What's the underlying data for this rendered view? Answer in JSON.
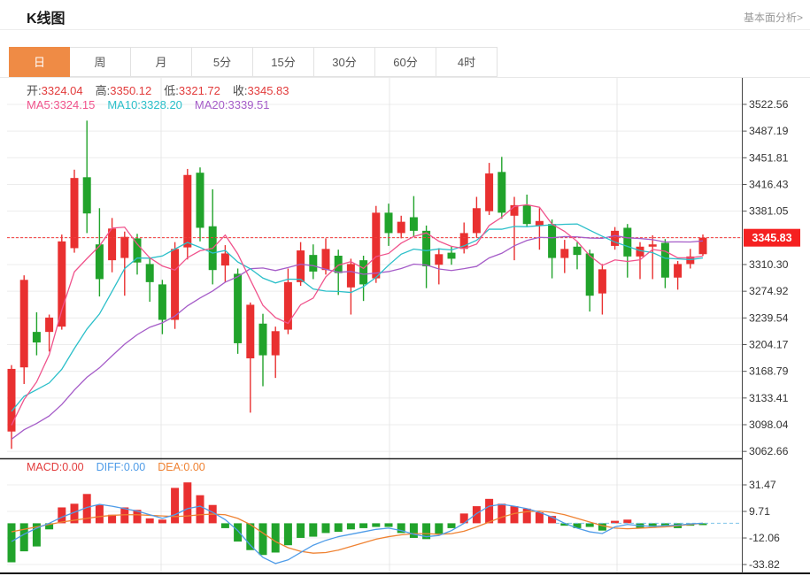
{
  "header": {
    "title": "K线图",
    "link": "基本面分析>"
  },
  "tabs": [
    {
      "label": "日",
      "active": true
    },
    {
      "label": "周",
      "active": false
    },
    {
      "label": "月",
      "active": false
    },
    {
      "label": "5分",
      "active": false
    },
    {
      "label": "15分",
      "active": false
    },
    {
      "label": "30分",
      "active": false
    },
    {
      "label": "60分",
      "active": false
    },
    {
      "label": "4时",
      "active": false
    }
  ],
  "ohlc": [
    {
      "label": "开:",
      "value": "3324.04"
    },
    {
      "label": "高:",
      "value": "3350.12"
    },
    {
      "label": "低:",
      "value": "3321.72"
    },
    {
      "label": "收:",
      "value": "3345.83"
    }
  ],
  "ma_legend": [
    {
      "label": "MA5:",
      "value": "3324.15",
      "color": "#f0538c"
    },
    {
      "label": "MA10:",
      "value": "3328.20",
      "color": "#2bbfc9"
    },
    {
      "label": "MA20:",
      "value": "3339.51",
      "color": "#a55cc8"
    }
  ],
  "macd_legend": [
    {
      "label": "MACD:",
      "value": "0.00",
      "color": "#e23b3b"
    },
    {
      "label": "DIFF:",
      "value": "0.00",
      "color": "#4f9ce8"
    },
    {
      "label": "DEA:",
      "value": "0.00",
      "color": "#ef8232"
    }
  ],
  "chart_data": {
    "type": "candlestick+macd",
    "title": "K线图",
    "legend_position": "top-left",
    "grid": true,
    "price_axis_ticks": [
      3522.56,
      3487.19,
      3451.81,
      3416.43,
      3381.05,
      3345.83,
      3310.3,
      3274.92,
      3239.54,
      3204.17,
      3168.79,
      3133.41,
      3098.04,
      3062.66
    ],
    "current_price": 3345.83,
    "current_price_label": "3345.83",
    "ma_current": {
      "ma5": 3324.15,
      "ma10": 3328.2,
      "ma20": 3339.51
    },
    "candles_ohlc": [
      [
        3089,
        3177,
        3066,
        3172
      ],
      [
        3174,
        3296,
        3152,
        3290
      ],
      [
        3221,
        3247,
        3190,
        3207
      ],
      [
        3221,
        3244,
        3195,
        3240
      ],
      [
        3228,
        3350,
        3224,
        3341
      ],
      [
        3332,
        3436,
        3326,
        3425
      ],
      [
        3426,
        3501,
        3352,
        3378
      ],
      [
        3337,
        3385,
        3268,
        3291
      ],
      [
        3316,
        3372,
        3300,
        3358
      ],
      [
        3319,
        3354,
        3269,
        3347
      ],
      [
        3345,
        3351,
        3297,
        3313
      ],
      [
        3311,
        3320,
        3261,
        3287
      ],
      [
        3284,
        3290,
        3218,
        3237
      ],
      [
        3237,
        3340,
        3225,
        3331
      ],
      [
        3333,
        3437,
        3317,
        3429
      ],
      [
        3432,
        3439,
        3341,
        3359
      ],
      [
        3361,
        3410,
        3284,
        3303
      ],
      [
        3309,
        3336,
        3287,
        3325
      ],
      [
        3298,
        3305,
        3192,
        3206
      ],
      [
        3186,
        3260,
        3114,
        3257
      ],
      [
        3232,
        3245,
        3149,
        3190
      ],
      [
        3190,
        3228,
        3160,
        3222
      ],
      [
        3224,
        3305,
        3218,
        3287
      ],
      [
        3287,
        3340,
        3282,
        3329
      ],
      [
        3323,
        3337,
        3291,
        3301
      ],
      [
        3303,
        3345,
        3297,
        3331
      ],
      [
        3322,
        3330,
        3270,
        3299
      ],
      [
        3280,
        3318,
        3244,
        3311
      ],
      [
        3316,
        3322,
        3262,
        3284
      ],
      [
        3292,
        3388,
        3286,
        3379
      ],
      [
        3379,
        3391,
        3335,
        3352
      ],
      [
        3352,
        3375,
        3345,
        3367
      ],
      [
        3373,
        3401,
        3347,
        3355
      ],
      [
        3355,
        3362,
        3279,
        3308
      ],
      [
        3310,
        3332,
        3284,
        3324
      ],
      [
        3326,
        3334,
        3310,
        3318
      ],
      [
        3331,
        3366,
        3325,
        3352
      ],
      [
        3352,
        3400,
        3346,
        3385
      ],
      [
        3381,
        3445,
        3376,
        3431
      ],
      [
        3433,
        3453,
        3371,
        3379
      ],
      [
        3375,
        3400,
        3316,
        3389
      ],
      [
        3389,
        3403,
        3360,
        3364
      ],
      [
        3362,
        3385,
        3330,
        3368
      ],
      [
        3364,
        3370,
        3292,
        3319
      ],
      [
        3319,
        3343,
        3299,
        3331
      ],
      [
        3334,
        3340,
        3304,
        3323
      ],
      [
        3325,
        3330,
        3248,
        3269
      ],
      [
        3272,
        3311,
        3244,
        3304
      ],
      [
        3335,
        3360,
        3330,
        3355
      ],
      [
        3359,
        3364,
        3293,
        3321
      ],
      [
        3321,
        3340,
        3291,
        3334
      ],
      [
        3334,
        3349,
        3291,
        3337
      ],
      [
        3339,
        3344,
        3279,
        3293
      ],
      [
        3293,
        3315,
        3277,
        3311
      ],
      [
        3311,
        3331,
        3305,
        3321
      ],
      [
        3324.04,
        3350.12,
        3321.72,
        3345.83
      ]
    ],
    "macd_axis_ticks": [
      31.47,
      9.71,
      -12.06,
      -33.82
    ],
    "macd_current": {
      "macd": 0.0,
      "diff": 0.0,
      "dea": 0.0
    },
    "macd_bars": [
      -32,
      -23,
      -19,
      -5,
      13,
      16,
      24,
      15,
      7,
      13,
      11,
      4,
      3,
      29,
      33.5,
      23,
      15,
      -4,
      -15,
      -22,
      -26,
      -24,
      -18,
      -12,
      -11,
      -8,
      -7,
      -5,
      -4,
      -3,
      -3,
      -8,
      -12,
      -13,
      -9,
      -4,
      8,
      14,
      20,
      16,
      14,
      12,
      9,
      6,
      -2,
      -4,
      -3,
      -6,
      2,
      3,
      -4,
      -3,
      -2,
      -4,
      -2,
      -1.5
    ],
    "diff_line": [
      -15,
      -9,
      -4,
      0,
      5,
      9,
      13,
      15.5,
      14,
      12,
      10,
      7,
      4,
      7,
      12,
      14,
      9,
      3,
      -6,
      -18,
      -28,
      -33,
      -30,
      -24,
      -18,
      -14,
      -11,
      -9,
      -7,
      -5,
      -4,
      -6,
      -9,
      -11,
      -10,
      -6,
      0,
      8,
      14,
      15.5,
      14,
      12,
      9,
      5,
      0,
      -4,
      -7,
      -8.4,
      -3,
      -1,
      -2,
      -2.5,
      -2,
      -1.5,
      -0.5,
      0
    ],
    "dea_line": [
      -7,
      -5,
      -3,
      -1,
      1,
      2.5,
      4,
      5.5,
      6.5,
      7,
      7,
      6.5,
      6,
      5.5,
      6,
      7,
      7.5,
      7,
      4,
      -1,
      -8,
      -15,
      -20,
      -23,
      -24.5,
      -24,
      -22,
      -19,
      -16,
      -13,
      -11,
      -9.5,
      -8.5,
      -8.5,
      -9,
      -8.5,
      -6.5,
      -3,
      1,
      5,
      8,
      9.5,
      10,
      9,
      7,
      4,
      1,
      -2,
      -4,
      -4.5,
      -4,
      -3.5,
      -3,
      -2,
      -1,
      0
    ],
    "colors": {
      "up": "#e93030",
      "down": "#21a32b",
      "ma5": "#f0538c",
      "ma10": "#2bbfc9",
      "ma20": "#a55cc8",
      "diff": "#4f9ce8",
      "dea": "#ef8232",
      "price_line": "#f43b3b",
      "badge_bg": "#f52020",
      "badge_text": "#ffffff",
      "tab_active": "#ef8b45",
      "axis_text": "#333333"
    }
  }
}
